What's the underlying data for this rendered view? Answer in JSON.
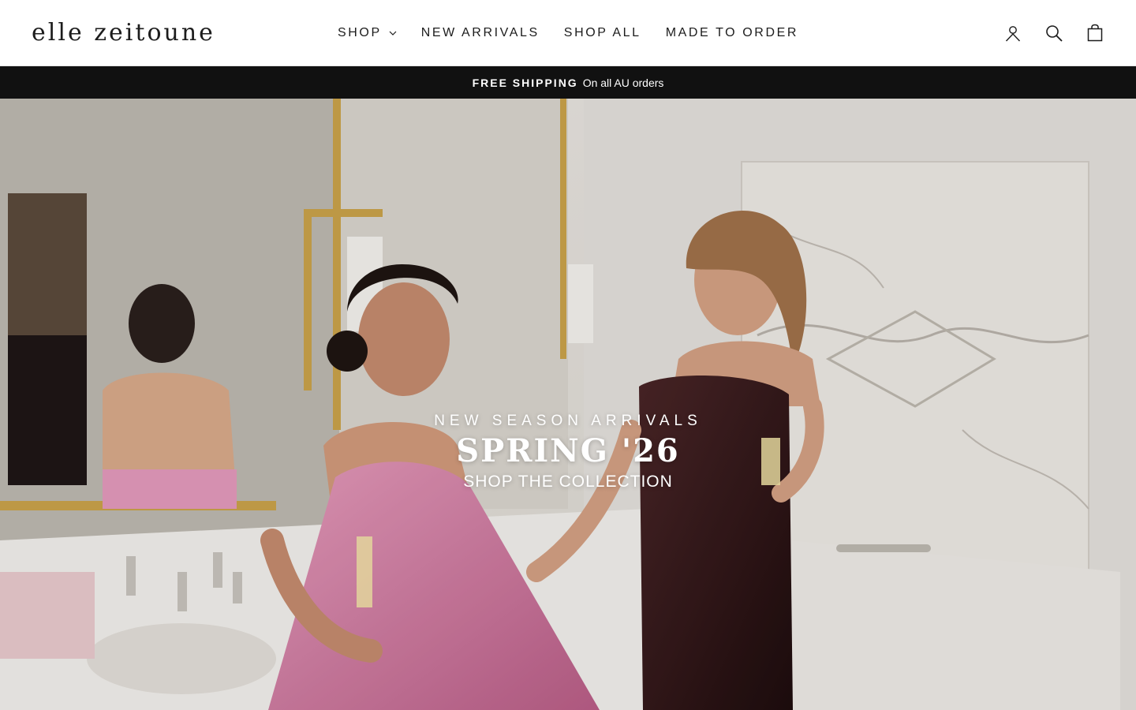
{
  "brand": {
    "logo_text": "elle zeitoune"
  },
  "nav": {
    "items": [
      {
        "label": "SHOP",
        "has_dropdown": true
      },
      {
        "label": "NEW ARRIVALS"
      },
      {
        "label": "SHOP ALL"
      },
      {
        "label": "MADE TO ORDER"
      }
    ]
  },
  "header_icons": [
    "account-icon",
    "search-icon",
    "cart-icon"
  ],
  "announcement": {
    "strong": "FREE SHIPPING",
    "text": "On all AU orders"
  },
  "hero": {
    "eyebrow": "NEW SEASON ARRIVALS",
    "headline": "SPRING '26",
    "cta": "SHOP THE COLLECTION"
  },
  "colors": {
    "announcement_bg": "#111111",
    "text_dark": "#1c1c1c",
    "pink_dress": "#d27aa0",
    "burgundy_dress": "#2b1416"
  }
}
